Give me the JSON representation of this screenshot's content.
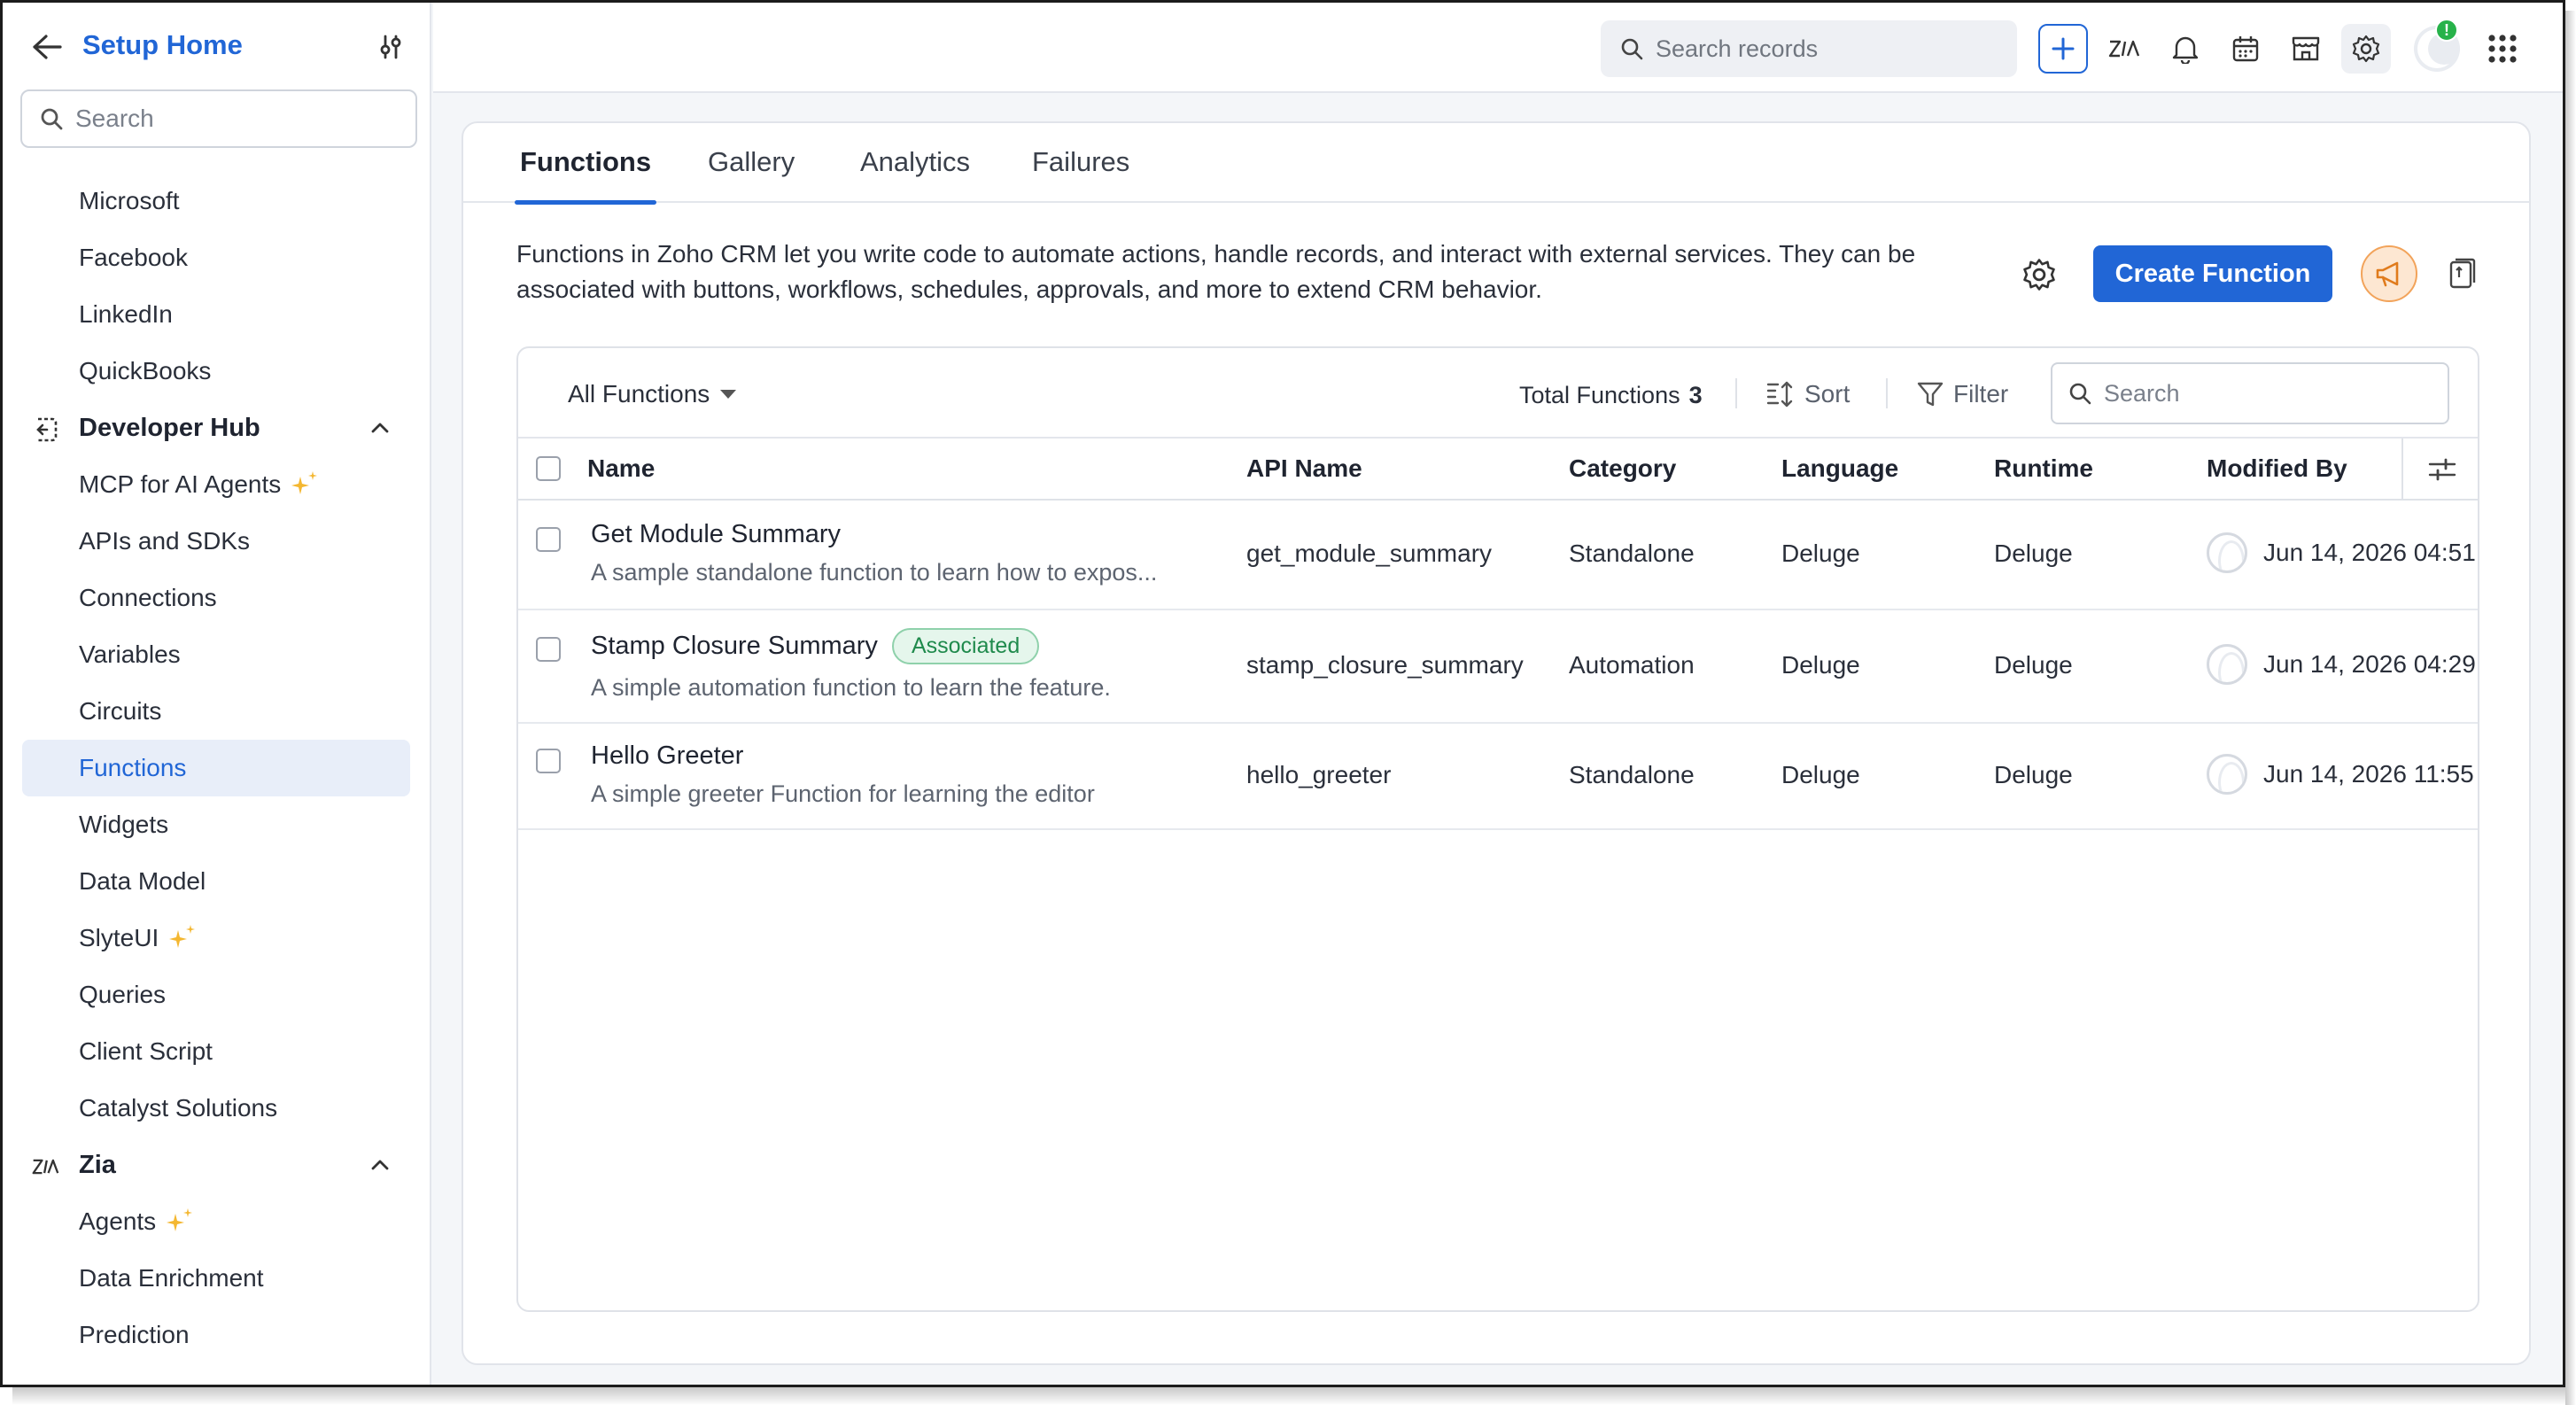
{
  "sidebar": {
    "title": "Setup Home",
    "search_placeholder": "Search",
    "items": [
      {
        "label": "Microsoft"
      },
      {
        "label": "Facebook"
      },
      {
        "label": "LinkedIn"
      },
      {
        "label": "QuickBooks"
      }
    ],
    "sections": [
      {
        "label": "Developer Hub",
        "icon": "developer-hub-icon",
        "items": [
          {
            "label": "MCP for AI Agents",
            "sparkle": true
          },
          {
            "label": "APIs and SDKs"
          },
          {
            "label": "Connections"
          },
          {
            "label": "Variables"
          },
          {
            "label": "Circuits"
          },
          {
            "label": "Functions",
            "active": true
          },
          {
            "label": "Widgets"
          },
          {
            "label": "Data Model"
          },
          {
            "label": "SlyteUI",
            "sparkle": true
          },
          {
            "label": "Queries"
          },
          {
            "label": "Client Script"
          },
          {
            "label": "Catalyst Solutions"
          }
        ]
      },
      {
        "label": "Zia",
        "icon": "zia-icon",
        "items": [
          {
            "label": "Agents",
            "sparkle": true
          },
          {
            "label": "Data Enrichment"
          },
          {
            "label": "Prediction"
          }
        ]
      }
    ]
  },
  "topbar": {
    "search_placeholder": "Search records",
    "notification_badge": "!"
  },
  "tabs": [
    "Functions",
    "Gallery",
    "Analytics",
    "Failures"
  ],
  "description": {
    "line1": "Functions in Zoho CRM let you write code to automate actions, handle records, and interact with external services. They can be",
    "line2": "associated with buttons, workflows, schedules, approvals, and more to extend CRM behavior."
  },
  "create_button": "Create Function",
  "table": {
    "filter_label": "All Functions",
    "total_label": "Total Functions",
    "total_count": "3",
    "sort_label": "Sort",
    "filter_button": "Filter",
    "search_placeholder": "Search",
    "columns": {
      "name": "Name",
      "api": "API Name",
      "category": "Category",
      "language": "Language",
      "runtime": "Runtime",
      "modified": "Modified By"
    },
    "rows": [
      {
        "name": "Get Module Summary",
        "desc": "A sample standalone function to learn how to expos...",
        "badge": "",
        "api": "get_module_summary",
        "category": "Standalone",
        "language": "Deluge",
        "runtime": "Deluge",
        "modified": "Jun 14, 2026 04:51"
      },
      {
        "name": "Stamp Closure Summary",
        "desc": "A simple automation function to learn the feature.",
        "badge": "Associated",
        "api": "stamp_closure_summary",
        "category": "Automation",
        "language": "Deluge",
        "runtime": "Deluge",
        "modified": "Jun 14, 2026 04:29"
      },
      {
        "name": "Hello Greeter",
        "desc": "A simple greeter Function for learning the editor",
        "badge": "",
        "api": "hello_greeter",
        "category": "Standalone",
        "language": "Deluge",
        "runtime": "Deluge",
        "modified": "Jun 14, 2026 11:55"
      }
    ]
  },
  "colors": {
    "accent": "#2166d6",
    "badge_green": "#1f8a4c",
    "sparkle": "#f4b731",
    "announce": "#f2a35a"
  }
}
